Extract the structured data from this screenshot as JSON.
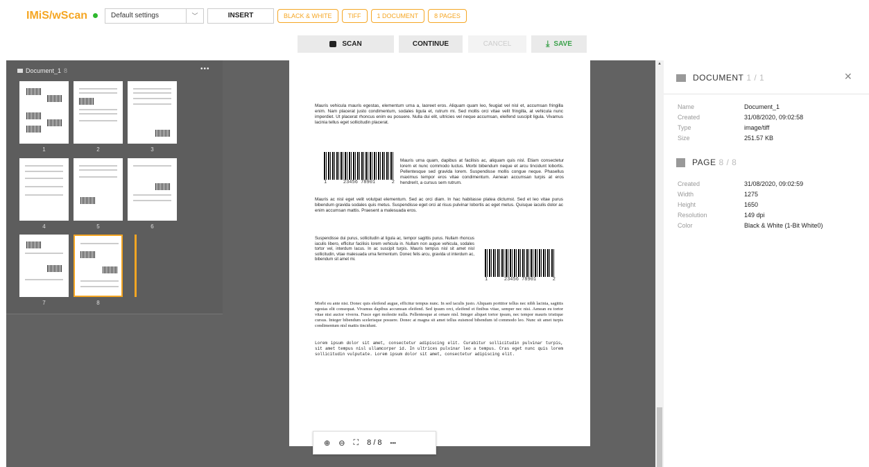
{
  "app": {
    "brand": "IMiS/wScan",
    "status_color": "#2eb82e",
    "accent": "#f5a623"
  },
  "topbar": {
    "profile": "Default settings",
    "insert": "INSERT",
    "chips": [
      "BLACK & WHITE",
      "TIFF",
      "1 DOCUMENT",
      "8 PAGES"
    ]
  },
  "toolbar": {
    "scan": "SCAN",
    "continue": "CONTINUE",
    "cancel": "CANCEL",
    "save": "SAVE"
  },
  "document_panel": {
    "name": "Document_1",
    "count": "8",
    "pages": [
      "1",
      "2",
      "3",
      "4",
      "5",
      "6",
      "7",
      "8"
    ],
    "selected_page": "8"
  },
  "preview": {
    "para1": "Mauris vehicula mauris egestas, elementum urna a, laoreet eros. Aliquam quam leo, feugiat vel nisl et, accumsan fringilla enim. Nam placerat justo condimentum, sodales ligula et, rutrum mi. Sed mollis orci vitae velit fringilla, at vehicula nunc imperdiet. Ut placerat rhoncus enim eu posuere. Nulla dui elit, ultricies vel neque accumsan, eleifend suscipit ligula. Vivamus lacinia tellus eget sollicitudin placerat.",
    "para2": "Mauris urna quam, dapibus at facilisis ac, aliquam quis nisl. Etiam consectetur lorem et nunc commodo luctus. Morbi bibendum neque et arcu tincidunt lobortis. Pellentesque sed gravida lorem. Suspendisse mollis congue neque. Phasellus maximus tempor eros vitae condimentum. Aenean accumsan turpis at eros hendrerit, a cursus sem rutrum.",
    "para3": "Mauris ac nisl eget velit volutpat elementum. Sed ac orci diam. In hac habitasse platea dictumst. Sed et leo vitae purus bibendum gravida sodales quis metus. Suspendisse eget orci at risus pulvinar lobortis ac eget metus. Quisque iaculis dolor ac enim accumsan mattis. Praesent a malesuada eros.",
    "para4": "Suspendisse dui purus, sollicitudin at ligula ac, tempor sagittis purus. Nullam rhoncus iaculis libero, efficitur facilisis lorem vehicula in. Nullam non augue vehicula, sodales tortor vel, interdum lacus. In ac suscipit turpis. Mauris tempus nisl sit amet nisl sollicitudin, vitae malesuada urna fermentum. Donec felis arcu, gravida ut interdum ac, bibendum sit amet mi.",
    "para5": "Morbi eu ante nisi. Donec quis eleifend augue, efficitur tempus nunc. In sed iaculis justo. Aliquam porttitor tellus nec nibh lacinia, sagittis egestas elit consequat. Vivamus dapibus accumsan eleifend. Sed ipsum orci, eleifend et finibus vitae, semper nec nisi. Aenean eu tortor vitae nisi auctor viverra. Fusce eget molestie nulla. Pellentesque at ornare nisl. Integer aliquet tortor ipsum, nec tempor mauris tristique cursus. Integer bibendum scelerisque posuere. Donec at magna sit amet tellus euismod bibendum id commodo leo. Nunc sit amet turpis condimentum nisl mattis tincidunt.",
    "para6": "Lorem ipsum dolor sit amet, consectetur adipiscing elit. Curabitur sollicitudin pulvinar turpis, sit amet tempus nisl ullamcorper id. In ultrices pulvinar leo a tempus. Cras eget nunc quis lorem sollicitudin vulputate. Lorem ipsum dolor sit amet, consectetur adipiscing elit.",
    "barcode_left": "1",
    "barcode_mid": "23456 78901",
    "barcode_right": "2"
  },
  "zoombar": {
    "zoom_in": "⊕",
    "zoom_out": "⊖",
    "fit": "⛶",
    "page": "8 / 8",
    "more": "•••"
  },
  "details": {
    "doc_title": "DOCUMENT",
    "doc_sub": "1 / 1",
    "doc": [
      {
        "k": "Name",
        "v": "Document_1"
      },
      {
        "k": "Created",
        "v": "31/08/2020, 09:02:58"
      },
      {
        "k": "Type",
        "v": "image/tiff"
      },
      {
        "k": "Size",
        "v": "251.57 KB"
      }
    ],
    "page_title": "PAGE",
    "page_sub": "8 / 8",
    "page": [
      {
        "k": "Created",
        "v": "31/08/2020, 09:02:59"
      },
      {
        "k": "Width",
        "v": "1275"
      },
      {
        "k": "Height",
        "v": "1650"
      },
      {
        "k": "Resolution",
        "v": "149 dpi"
      },
      {
        "k": "Color",
        "v": "Black & White (1-Bit White0)"
      }
    ]
  }
}
